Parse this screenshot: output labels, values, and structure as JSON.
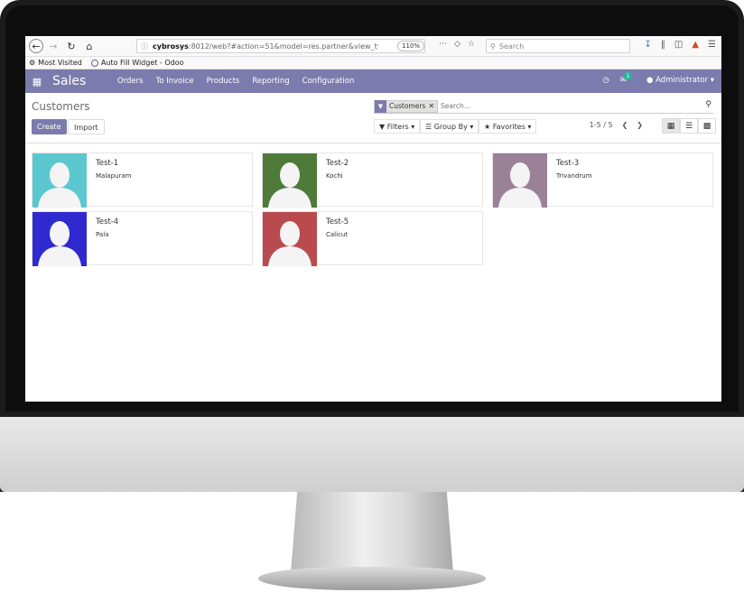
{
  "browser": {
    "url_host": "cybrosys",
    "url_rest": ":8012/web?#action=51&model=res.partner&view_type=...",
    "zoom": "110%",
    "search_placeholder": "Search",
    "bookmarks": [
      "Most Visited",
      "Auto Fill Widget - Odoo"
    ]
  },
  "app": {
    "brand": "Sales",
    "menu": [
      "Orders",
      "To Invoice",
      "Products",
      "Reporting",
      "Configuration"
    ],
    "chat_count": "1",
    "user": "Administrator",
    "navbar_color": "#7c7bad"
  },
  "control_panel": {
    "title": "Customers",
    "create": "Create",
    "import": "Import",
    "facet": "Customers",
    "search_placeholder": "Search...",
    "filters": "Filters",
    "group_by": "Group By",
    "favorites": "Favorites",
    "pager": "1-5 / 5"
  },
  "customers": [
    {
      "name": "Test-1",
      "city": "Malapuram",
      "color": "#5bc8cf"
    },
    {
      "name": "Test-2",
      "city": "Kochi",
      "color": "#4e7a3a"
    },
    {
      "name": "Test-3",
      "city": "Trivandrum",
      "color": "#9b8198"
    },
    {
      "name": "Test-4",
      "city": "Pala",
      "color": "#2f2ad0"
    },
    {
      "name": "Test-5",
      "city": "Calicut",
      "color": "#b94a4e"
    }
  ]
}
